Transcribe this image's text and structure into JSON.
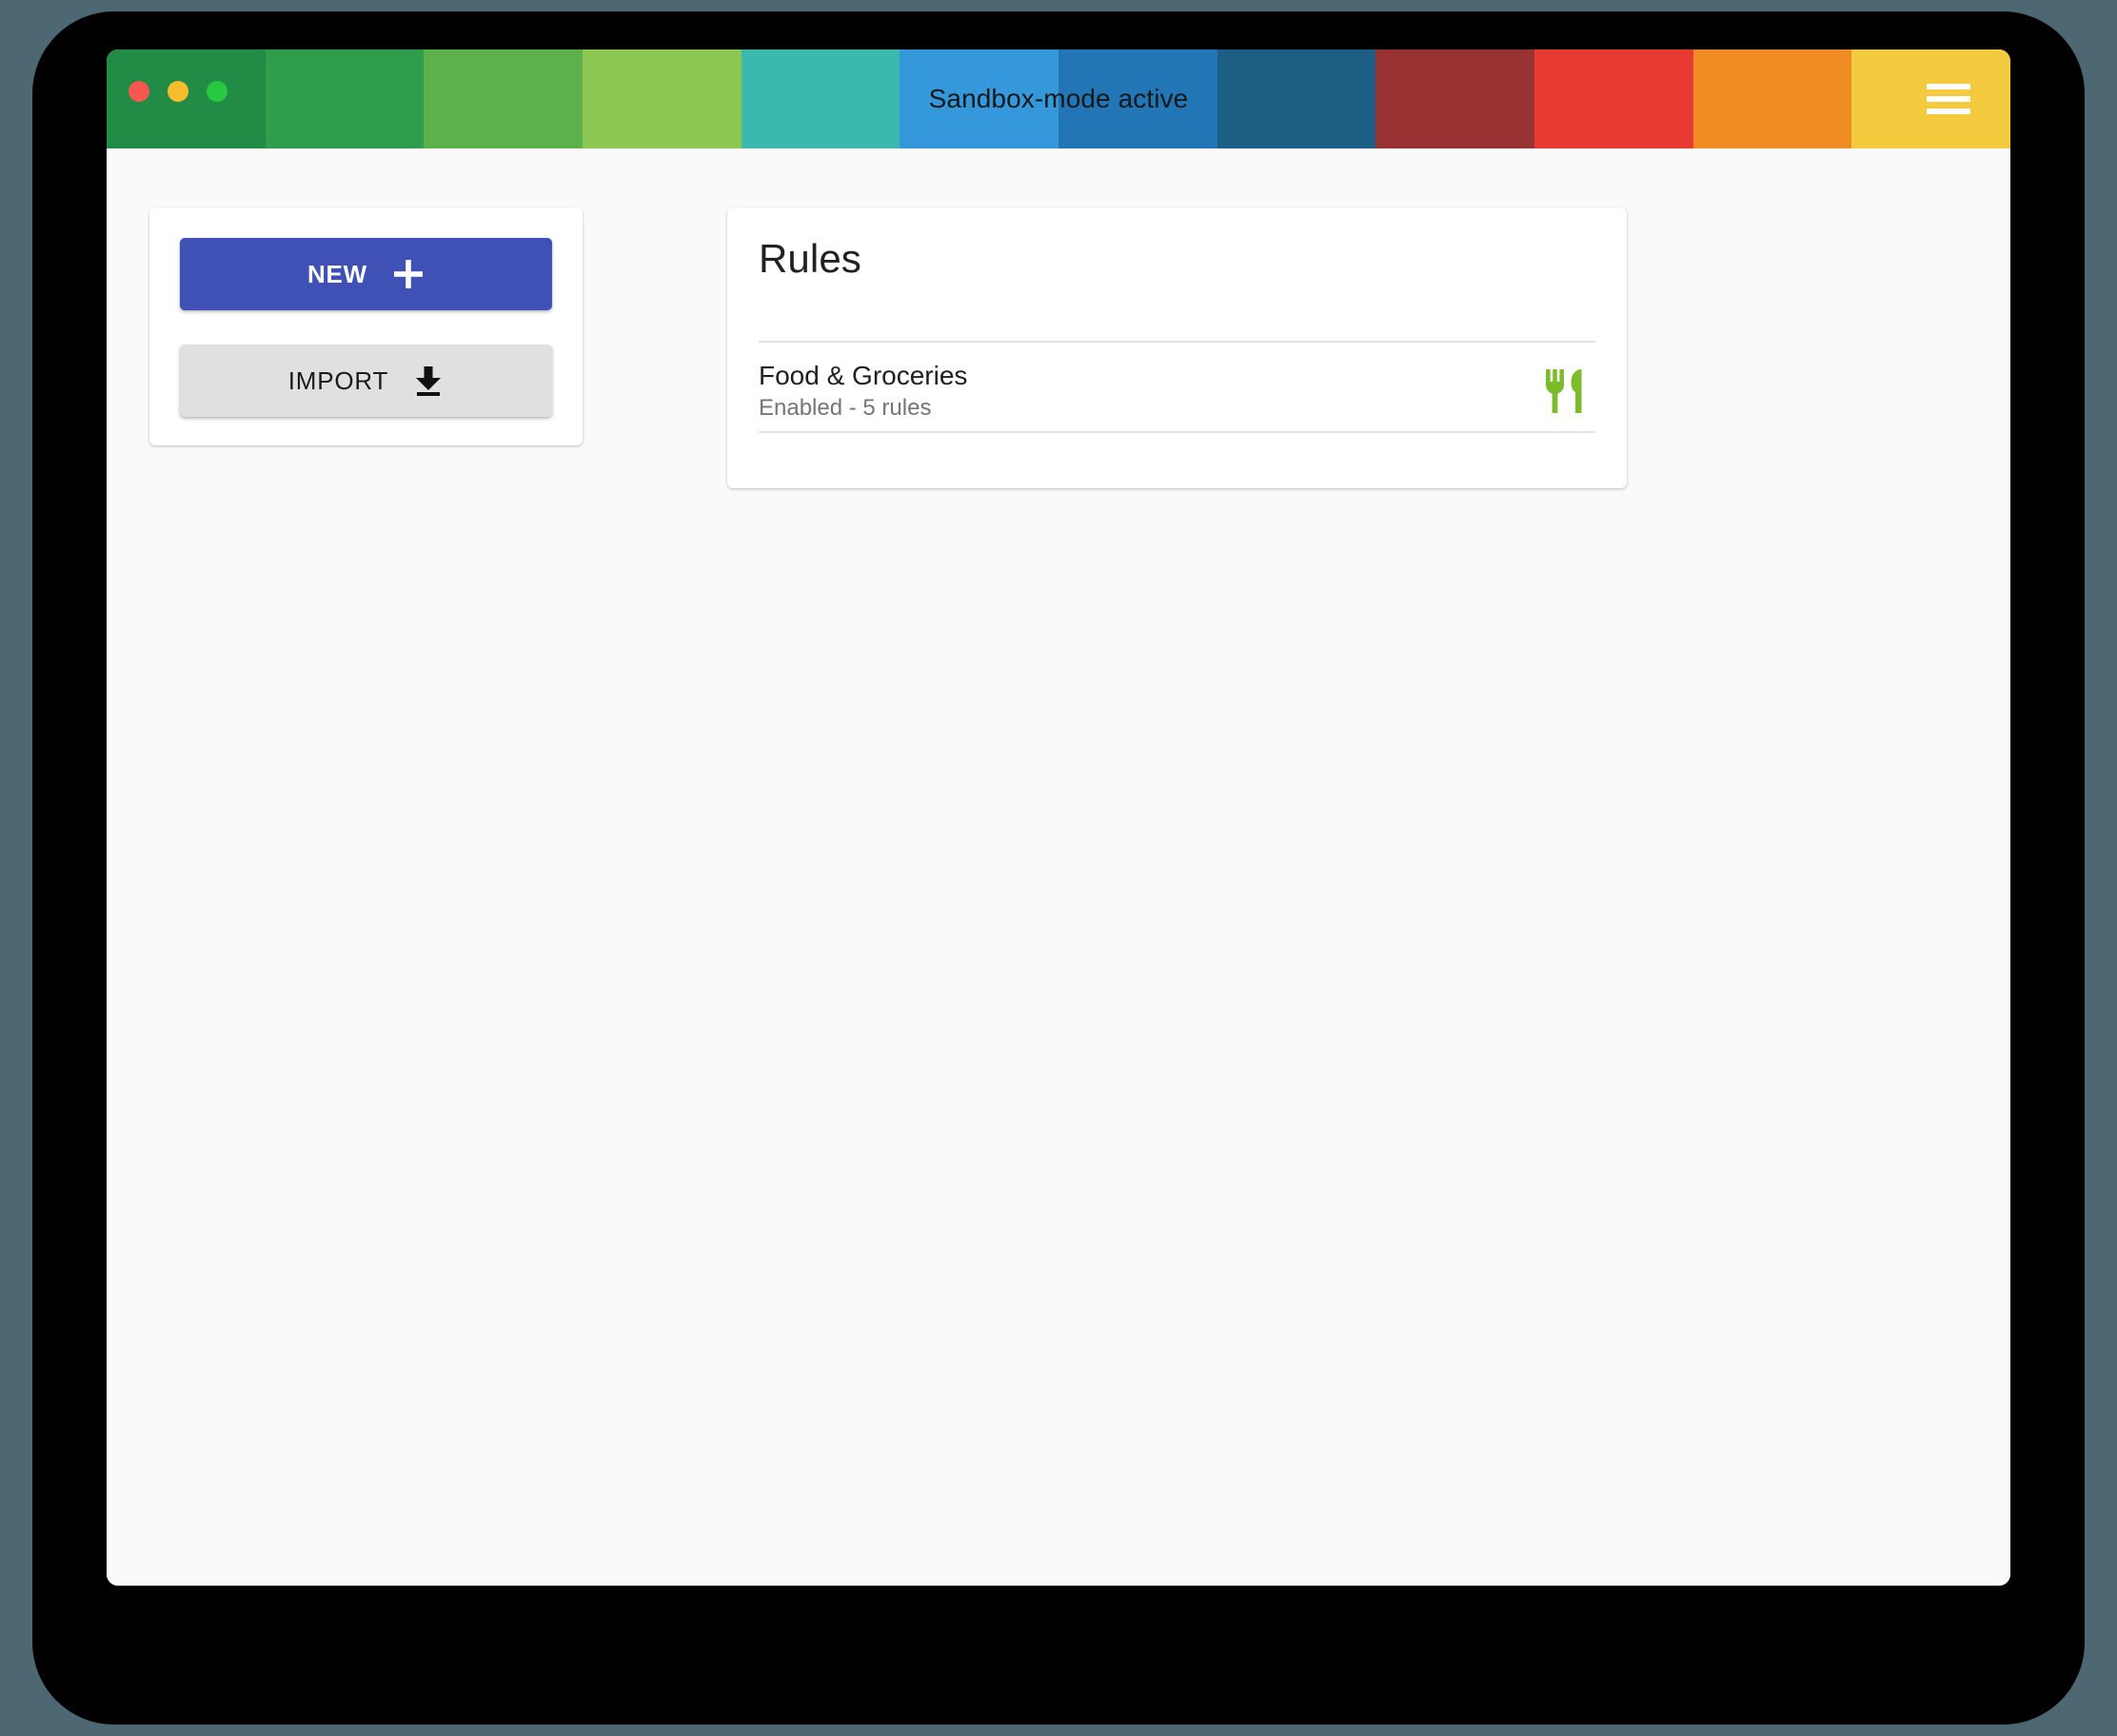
{
  "window": {
    "title": "Sandbox-mode active",
    "controls": [
      "close",
      "minimize",
      "maximize"
    ],
    "menu_icon": "hamburger-menu-icon",
    "title_bands": [
      "#228B45",
      "#2E9E4C",
      "#5CB14B",
      "#8CC751",
      "#3BB9AF",
      "#3498DB",
      "#2276B5",
      "#1D5E84",
      "#993333",
      "#E63A32",
      "#F08C24",
      "#F4CA3E"
    ]
  },
  "actions": {
    "new_label": "NEW",
    "new_icon": "plus-icon",
    "new_color": "#3F51B5",
    "import_label": "IMPORT",
    "import_icon": "download-icon",
    "import_color": "#E0E0E0"
  },
  "rules_panel": {
    "title": "Rules",
    "items": [
      {
        "name": "Food & Groceries",
        "status": "Enabled - 5 rules",
        "icon": "restaurant-icon",
        "icon_color": "#7CBB2C"
      }
    ]
  }
}
